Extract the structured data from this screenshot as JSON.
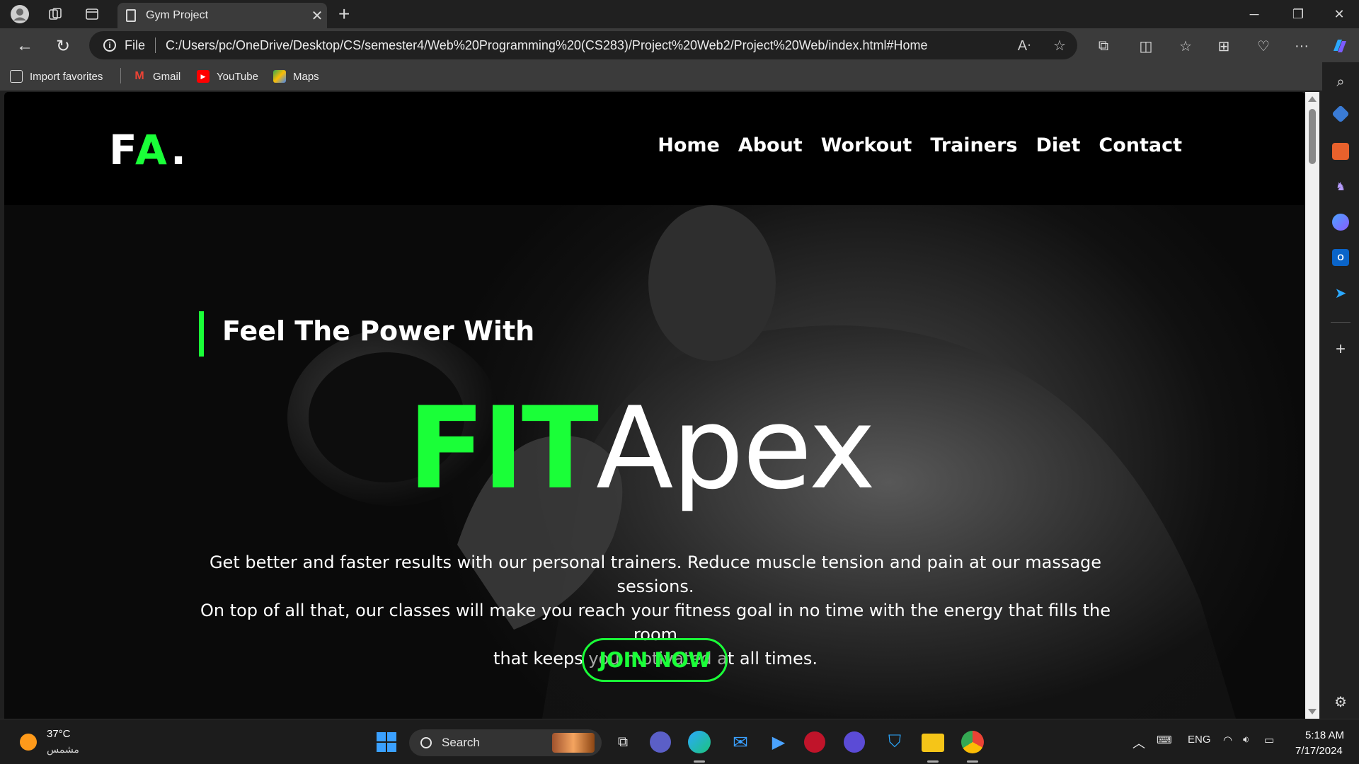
{
  "browser": {
    "tab_title": "Gym Project",
    "url_scheme_label": "File",
    "url": "C:/Users/pc/OneDrive/Desktop/CS/semester4/Web%20Programming%20(CS283)/Project%20Web2/Project%20Web/index.html#Home",
    "favorites": [
      {
        "label": "Import favorites",
        "icon": "import-icon"
      },
      {
        "label": "Gmail",
        "icon": "gmail-icon"
      },
      {
        "label": "YouTube",
        "icon": "youtube-icon"
      },
      {
        "label": "Maps",
        "icon": "maps-icon"
      }
    ]
  },
  "site": {
    "logo": {
      "first": "F",
      "second": "A",
      "dot": "."
    },
    "nav": [
      "Home",
      "About",
      "Workout",
      "Trainers",
      "Diet",
      "Contact"
    ],
    "hero": {
      "tagline": "Feel The Power With",
      "brand_green": "FIT",
      "brand_white": "Apex",
      "description_lines": [
        "Get better and faster results with our personal trainers. Reduce muscle tension and pain at our massage sessions.",
        "On top of all that, our classes will make you reach your fitness goal in no time with the energy that fills the room",
        "that keeps you motivated at all times."
      ],
      "cta": "JOIN NOW"
    },
    "colors": {
      "accent": "#1aff38",
      "header_bg": "#000000",
      "text": "#ffffff"
    }
  },
  "taskbar": {
    "weather_temp": "37°C",
    "weather_condition": "مشمس",
    "search_label": "Search",
    "language": "ENG",
    "time": "5:18 AM",
    "date": "7/17/2024"
  }
}
